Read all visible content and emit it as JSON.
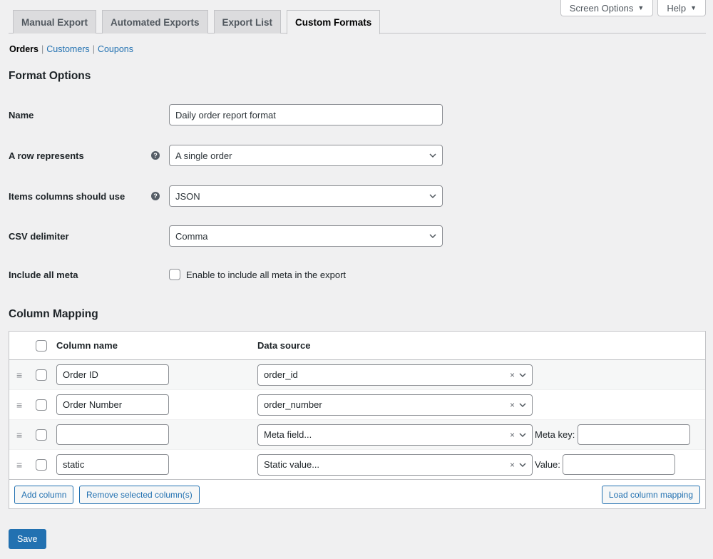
{
  "screen_meta": {
    "screen_options_label": "Screen Options",
    "help_label": "Help",
    "caret": "▼"
  },
  "tabs": [
    {
      "label": "Manual Export",
      "active": false
    },
    {
      "label": "Automated Exports",
      "active": false
    },
    {
      "label": "Export List",
      "active": false
    },
    {
      "label": "Custom Formats",
      "active": true
    }
  ],
  "subnav": {
    "current": "Orders",
    "links": [
      "Customers",
      "Coupons"
    ],
    "separator": "|"
  },
  "format_options": {
    "heading": "Format Options",
    "name_label": "Name",
    "name_value": "Daily order report format",
    "row_label": "A row represents",
    "row_value": "A single order",
    "items_label": "Items columns should use",
    "items_value": "JSON",
    "delimiter_label": "CSV delimiter",
    "delimiter_value": "Comma",
    "meta_label": "Include all meta",
    "meta_checkbox_label": "Enable to include all meta in the export",
    "help_glyph": "?"
  },
  "column_mapping": {
    "heading": "Column Mapping",
    "col_name_header": "Column name",
    "data_source_header": "Data source",
    "drag_glyph": "≡",
    "clear_glyph": "×",
    "rows": [
      {
        "name": "Order ID",
        "source": "order_id",
        "extra_label": "",
        "extra_value": ""
      },
      {
        "name": "Order Number",
        "source": "order_number",
        "extra_label": "",
        "extra_value": ""
      },
      {
        "name": "",
        "source": "Meta field...",
        "extra_label": "Meta key:",
        "extra_value": ""
      },
      {
        "name": "static",
        "source": "Static value...",
        "extra_label": "Value:",
        "extra_value": ""
      }
    ],
    "add_column_label": "Add column",
    "remove_selected_label": "Remove selected column(s)",
    "load_mapping_label": "Load column mapping"
  },
  "save_label": "Save",
  "colors": {
    "accent": "#2271b1",
    "background": "#f0f0f1"
  }
}
